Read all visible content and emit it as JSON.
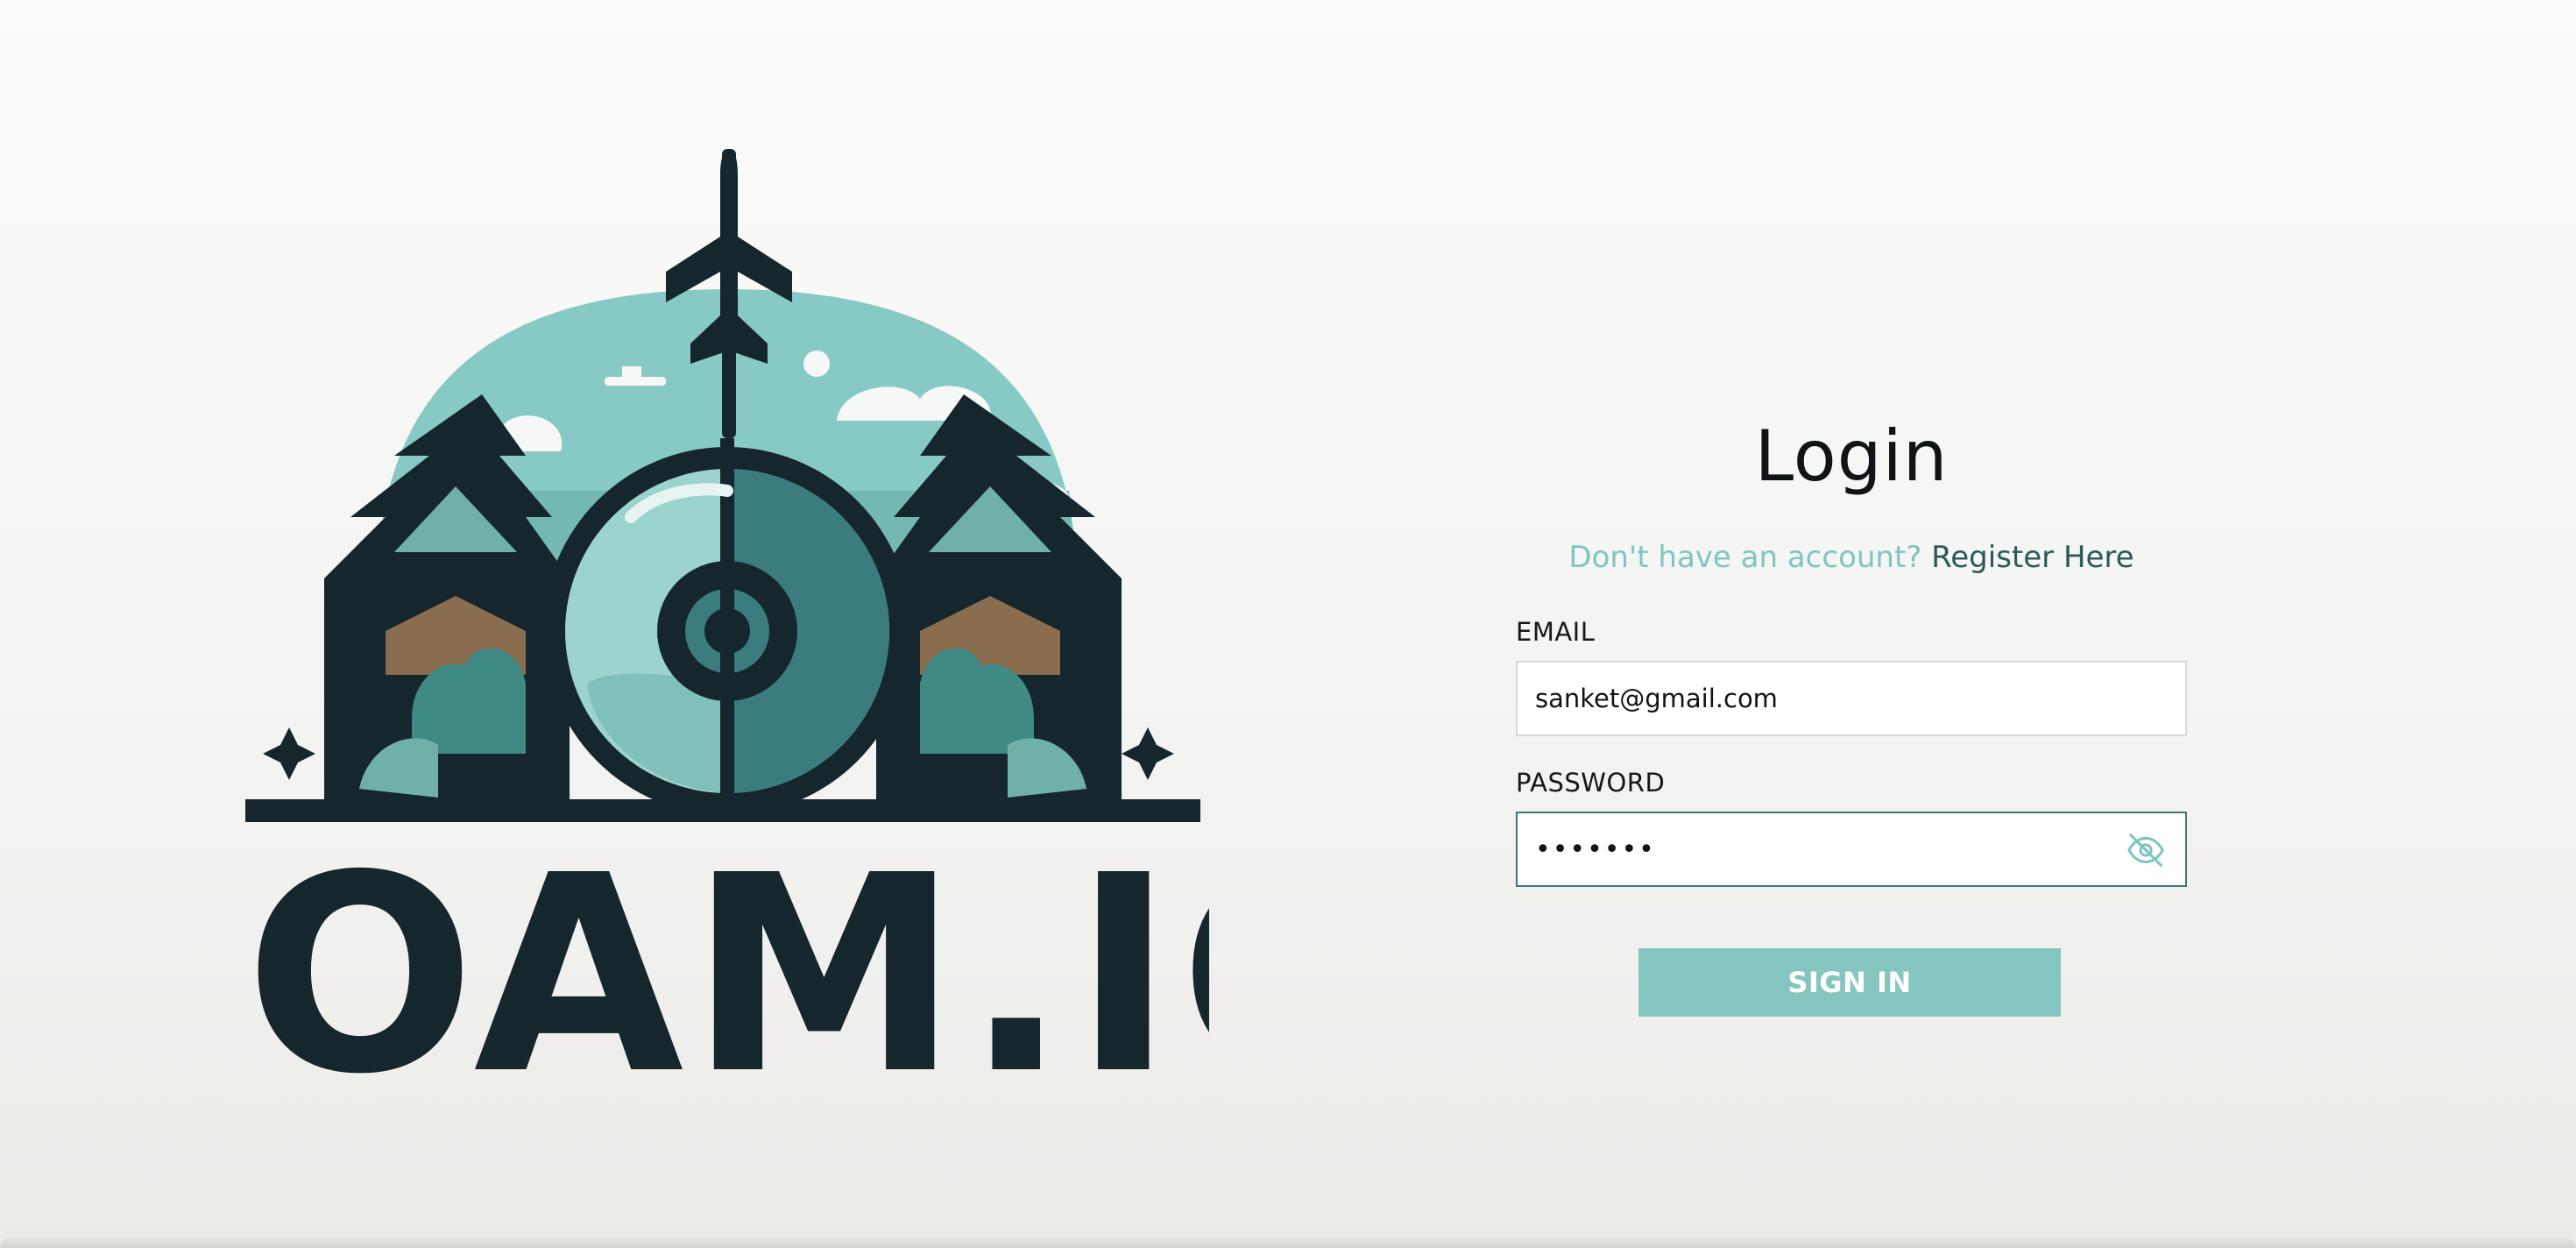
{
  "brand": {
    "logo_text": "ROAM.IO"
  },
  "login": {
    "title": "Login",
    "register_prompt": "Don't have an account?",
    "register_link": "Register Here",
    "email_label": "EMAIL",
    "email_value": "sanket@gmail.com",
    "password_label": "PASSWORD",
    "password_value": "sanket1",
    "password_toggle_icon": "eye-off-icon",
    "signin_label": "SIGN IN"
  },
  "colors": {
    "accent": "#85c7c0",
    "accent_text": "#7fc6c0",
    "link": "#2a5a59",
    "focused_border": "#3f7777",
    "logo_dark": "#16262d"
  }
}
